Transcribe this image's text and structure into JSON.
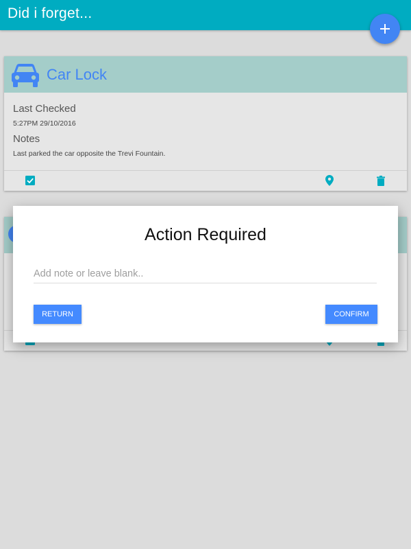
{
  "app": {
    "title": "Did i forget..."
  },
  "fab": {
    "icon": "plus-icon",
    "label": "+"
  },
  "cards": [
    {
      "title": "Car Lock",
      "icon": "car-icon",
      "last_checked_label": "Last Checked",
      "last_checked_value": "5:27PM 29/10/2016",
      "notes_label": "Notes",
      "notes_value": "Last parked the car opposite the Trevi Fountain.",
      "actions": [
        "checkbox-icon",
        "location-pin-icon",
        "trash-icon"
      ]
    }
  ],
  "dialog": {
    "title": "Action Required",
    "note_placeholder": "Add note or leave blank..",
    "note_value": "",
    "return_label": "RETURN",
    "confirm_label": "CONFIRM"
  },
  "colors": {
    "appbar": "#00acc1",
    "accent": "#4285f4",
    "card_header": "#a4cdc9",
    "action_icon": "#00acc1"
  }
}
